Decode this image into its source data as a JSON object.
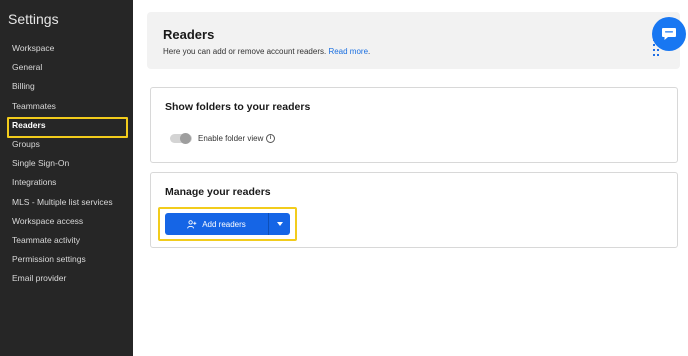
{
  "sidebar": {
    "title": "Settings",
    "items": [
      {
        "label": "Workspace"
      },
      {
        "label": "General"
      },
      {
        "label": "Billing"
      },
      {
        "label": "Teammates"
      },
      {
        "label": "Readers",
        "active": true
      },
      {
        "label": "Groups"
      },
      {
        "label": "Single Sign-On"
      },
      {
        "label": "Integrations"
      },
      {
        "label": "MLS - Multiple list services"
      },
      {
        "label": "Workspace access"
      },
      {
        "label": "Teammate activity"
      },
      {
        "label": "Permission settings"
      },
      {
        "label": "Email provider"
      }
    ]
  },
  "header": {
    "title": "Readers",
    "description": "Here you can add or remove account readers.",
    "read_more": "Read more",
    "period": "."
  },
  "folders_card": {
    "title": "Show folders to your readers",
    "toggle_label": "Enable folder view",
    "toggle_on": false
  },
  "manage_card": {
    "title": "Manage your readers",
    "add_button_label": "Add readers"
  },
  "icons": {
    "chat": "chat-bubble-icon",
    "drag": "drag-handle-icon",
    "info": "info-icon",
    "add_user": "add-user-icon",
    "caret": "chevron-down-icon"
  },
  "colors": {
    "sidebar_bg": "#262626",
    "accent_blue": "#1565e6",
    "highlight_yellow": "#f2cc1c",
    "link": "#1a6fe0"
  }
}
